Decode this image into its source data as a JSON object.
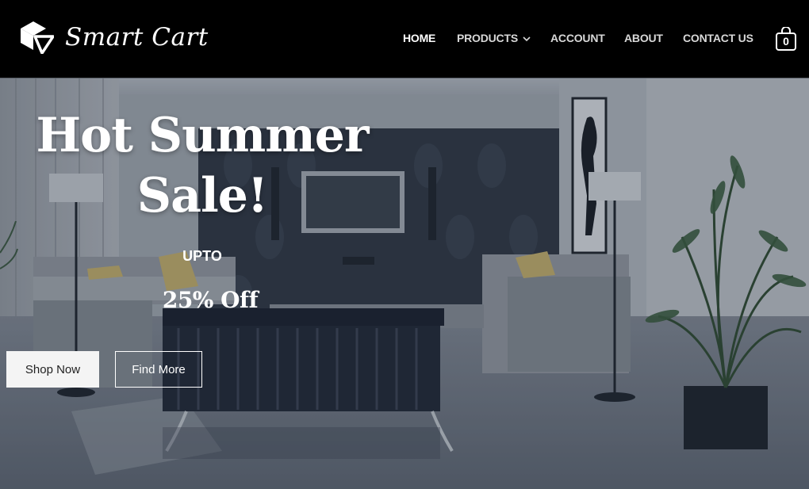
{
  "brand": {
    "name": "Smart Cart"
  },
  "nav": {
    "home": "HOME",
    "products": "PRODUCTS",
    "account": "ACCOUNT",
    "about": "ABOUT",
    "contact": "CONTACT US"
  },
  "cart": {
    "count": "0"
  },
  "hero": {
    "title_line1": "Hot Summer",
    "title_line2": "Sale!",
    "upto": "UPTO",
    "discount": "25% Off",
    "shop_button": "Shop Now",
    "find_button": "Find More"
  },
  "icons": {
    "logo": "cube-arrow-logo-icon",
    "products_dropdown": "chevron-down-icon",
    "cart": "shopping-bag-icon"
  },
  "colors": {
    "header_bg": "#000000",
    "nav_text": "#d8d8d8",
    "nav_active": "#ffffff",
    "hero_tint": "#4a5564"
  }
}
